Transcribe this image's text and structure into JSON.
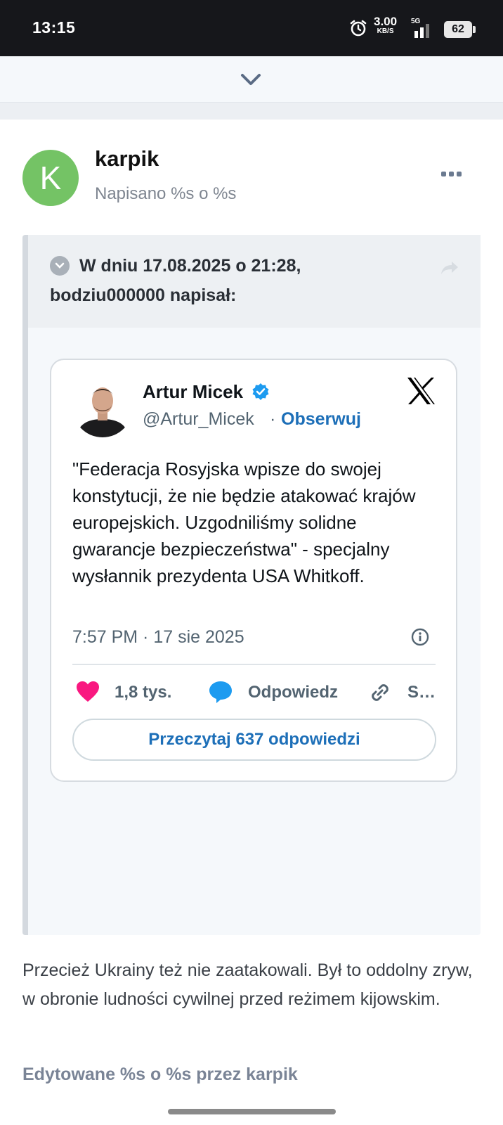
{
  "status_bar": {
    "time": "13:15",
    "speed_value": "3.00",
    "speed_unit": "KB/S",
    "network": "5G",
    "battery": "62"
  },
  "post": {
    "avatar_letter": "K",
    "author": "karpik",
    "posted": "Napisano %s o %s",
    "quote": {
      "header_line1": "W dniu 17.08.2025 o 21:28,",
      "header_line2": "bodziu000000 napisał:"
    },
    "tweet": {
      "name": "Artur Micek",
      "handle": "@Artur_Micek",
      "separator": "·",
      "follow": "Obserwuj",
      "text": "\"Federacja Rosyjska wpisze do swojej konstytucji, że nie będzie atakować krajów europejskich. Uzgodniliśmy solidne gwarancje bezpieczeństwa\" - specjalny wysłannik prezydenta USA Whitkoff.",
      "time": "7:57 PM · 17 sie 2025",
      "likes": "1,8 tys.",
      "reply": "Odpowiedz",
      "share": "S…",
      "read_replies": "Przeczytaj 637 odpowiedzi"
    },
    "body": "Przecież Ukrainy też nie zaatakowali. Był to oddolny zryw, w obronie ludności cywilnej przed reżimem kijowskim.",
    "edited": "Edytowane %s o %s przez karpik"
  },
  "colors": {
    "avatar": "#74c365",
    "link": "#1d6fb8",
    "heart": "#f91880",
    "reply_bubble": "#1d9bf0"
  }
}
